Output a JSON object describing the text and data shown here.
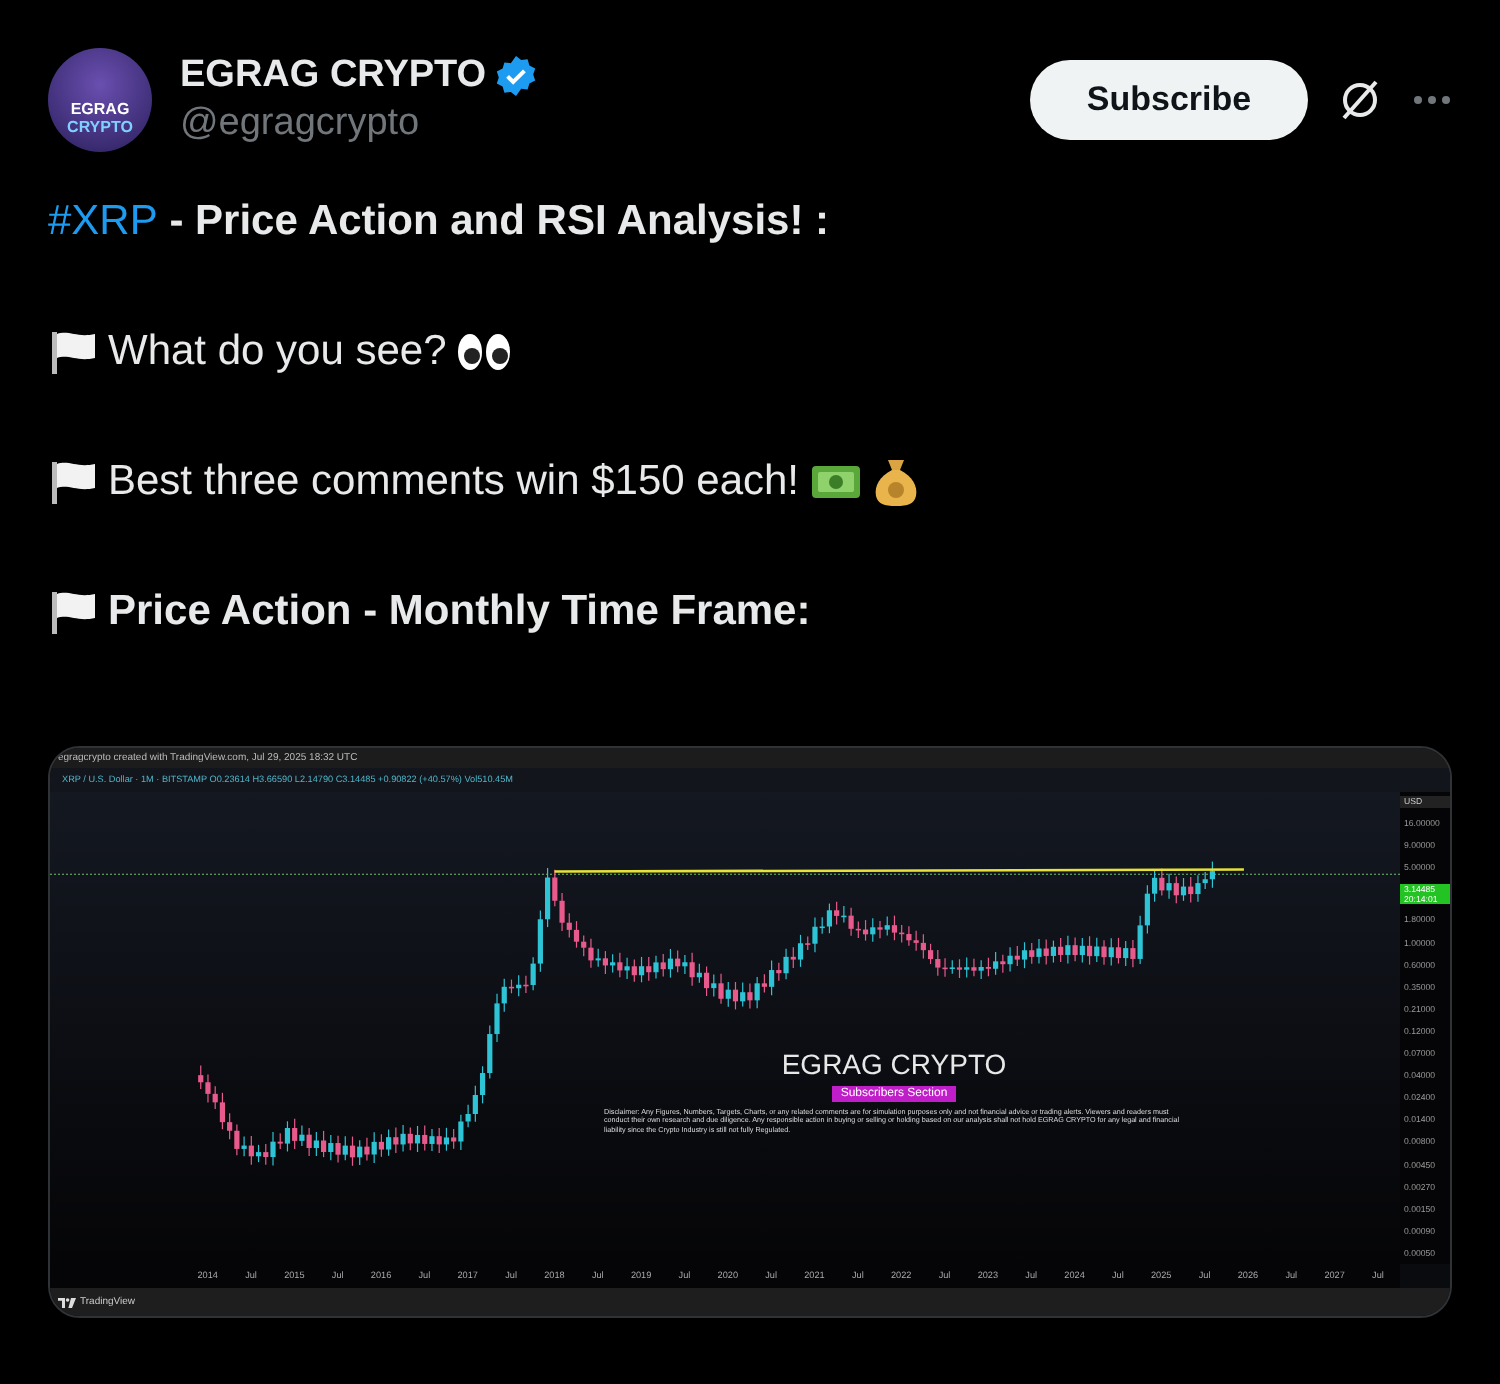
{
  "author": {
    "avatar_lines": [
      "EGRAG",
      "CRYPTO"
    ],
    "name": "EGRAG CRYPTO",
    "handle": "@egragcrypto"
  },
  "actions": {
    "subscribe": "Subscribe"
  },
  "tweet_lines": [
    {
      "parts": [
        {
          "kind": "hashtag",
          "text": "#XRP"
        },
        {
          "kind": "bold",
          "text": " - Price Action and RSI Analysis! :"
        }
      ]
    },
    {
      "parts": [
        {
          "kind": "flag"
        },
        {
          "kind": "plain",
          "text": "What do you see?"
        },
        {
          "kind": "eyes"
        }
      ]
    },
    {
      "parts": [
        {
          "kind": "flag"
        },
        {
          "kind": "plain",
          "text": "Best three comments win $150 each!"
        },
        {
          "kind": "banknote"
        },
        {
          "kind": "moneybag"
        }
      ]
    },
    {
      "parts": [
        {
          "kind": "flag"
        },
        {
          "kind": "bold",
          "text": "Price Action - Monthly Time Frame:"
        }
      ]
    }
  ],
  "chart_image": {
    "caption": "egragcrypto created with TradingView.com, Jul 29, 2025 18:32 UTC",
    "legend": "XRP / U.S. Dollar · 1M · BITSTAMP O0.23614 H3.66590 L2.14790 C3.14485 +0.90822 (+40.57%) Vol510.45M",
    "watermark": "EGRAG CRYPTO",
    "badge": "Subscribers Section",
    "disclaimer": "Disclaimer: Any Figures, Numbers, Targets, Charts, or any related comments are for simulation purposes only and not financial advice or trading alerts. Viewers and readers must conduct their own research and due diligence. Any responsible action in buying or selling or holding based on our analysis shall not hold EGRAG CRYPTO for any legal and financial liability since the Crypto Industry is still not fully Regulated.",
    "y_axis": [
      {
        "kind": "unit",
        "text": "USD"
      },
      {
        "kind": "tick",
        "text": "16.00000"
      },
      {
        "kind": "tick",
        "text": "9.00000"
      },
      {
        "kind": "tick",
        "text": "5.00000"
      },
      {
        "kind": "price",
        "text": "3.14485",
        "sub": "20:14:01"
      },
      {
        "kind": "tick",
        "text": "1.80000"
      },
      {
        "kind": "tick",
        "text": "1.00000"
      },
      {
        "kind": "tick",
        "text": "0.60000"
      },
      {
        "kind": "tick",
        "text": "0.35000"
      },
      {
        "kind": "tick",
        "text": "0.21000"
      },
      {
        "kind": "tick",
        "text": "0.12000"
      },
      {
        "kind": "tick",
        "text": "0.07000"
      },
      {
        "kind": "tick",
        "text": "0.04000"
      },
      {
        "kind": "tick",
        "text": "0.02400"
      },
      {
        "kind": "tick",
        "text": "0.01400"
      },
      {
        "kind": "tick",
        "text": "0.00800"
      },
      {
        "kind": "tick",
        "text": "0.00450"
      },
      {
        "kind": "tick",
        "text": "0.00270"
      },
      {
        "kind": "tick",
        "text": "0.00150"
      },
      {
        "kind": "tick",
        "text": "0.00090"
      },
      {
        "kind": "tick",
        "text": "0.00050"
      }
    ],
    "x_axis": [
      "2014",
      "Jul",
      "2015",
      "Jul",
      "2016",
      "Jul",
      "2017",
      "Jul",
      "2018",
      "Jul",
      "2019",
      "Jul",
      "2020",
      "Jul",
      "2021",
      "Jul",
      "2022",
      "Jul",
      "2023",
      "Jul",
      "2024",
      "Jul",
      "2025",
      "Jul",
      "2026",
      "Jul",
      "2027",
      "Jul"
    ],
    "footer": "TradingView"
  }
}
